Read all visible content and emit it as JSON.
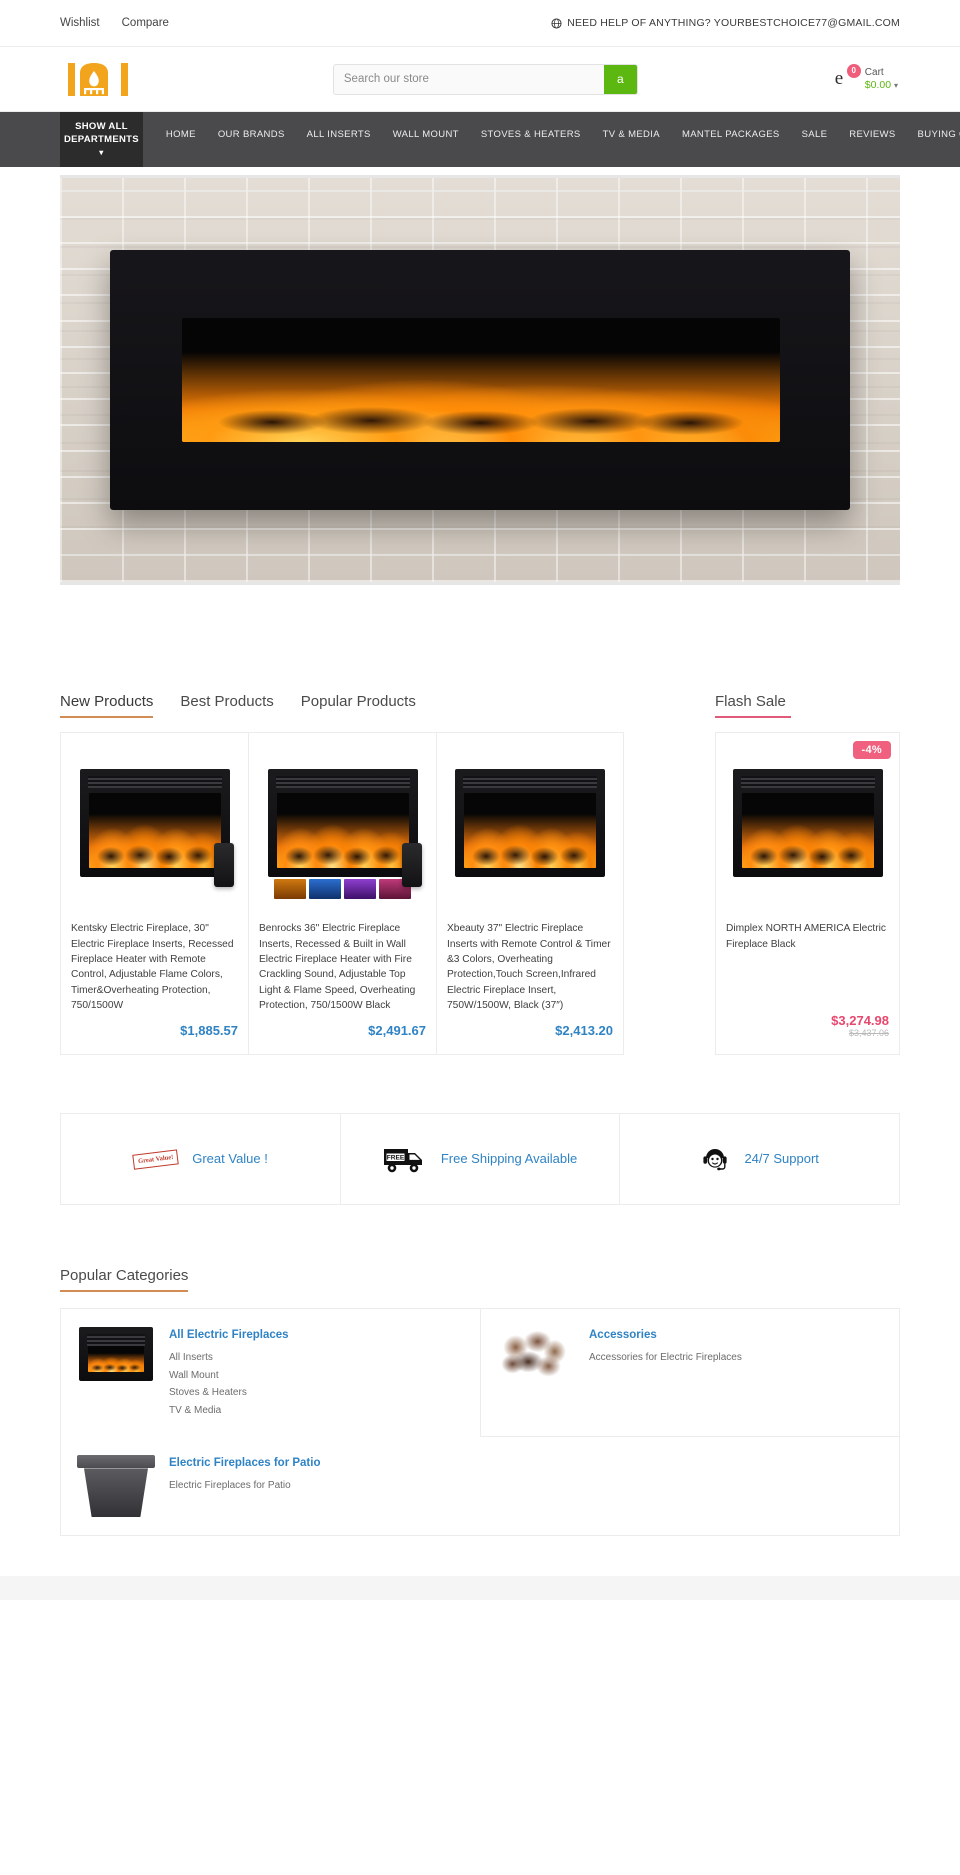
{
  "topbar": {
    "wishlist": "Wishlist",
    "compare": "Compare",
    "help_icon": "globe-icon",
    "help_text": "NEED HELP OF ANYTHING? YOURBESTCHOICE77@GMAIL.COM"
  },
  "header": {
    "logo_icon": "fireplace-logo-icon",
    "search": {
      "placeholder": "Search our store",
      "value": "",
      "button_label": "a",
      "button_color": "#5cb811"
    },
    "cart": {
      "icon_glyph": "e",
      "badge_count": "0",
      "label": "Cart",
      "total": "$0.00",
      "caret": "▾",
      "badge_color": "#f05d7a",
      "total_color": "#5cb811"
    }
  },
  "nav": {
    "departments_button": "SHOW ALL DEPARTMENTS",
    "departments_caret": "▾",
    "links": [
      "HOME",
      "OUR BRANDS",
      "ALL INSERTS",
      "WALL MOUNT",
      "STOVES & HEATERS",
      "TV & MEDIA",
      "MANTEL PACKAGES",
      "SALE",
      "REVIEWS",
      "BUYING GUIDE"
    ]
  },
  "hero": {
    "alt": "wall-mounted electric fireplace on white brick wall"
  },
  "products_section": {
    "tabs": [
      {
        "label": "New Products",
        "active": true
      },
      {
        "label": "Best Products",
        "active": false
      },
      {
        "label": "Popular Products",
        "active": false
      }
    ],
    "tab_accent": "#d08c52",
    "flash_heading": "Flash Sale",
    "flash_accent": "#e05a7a",
    "items": [
      {
        "title": "Kentsky Electric Fireplace, 30\" Electric Fireplace Inserts, Recessed Fireplace Heater with Remote Control, Adjustable Flame Colors, Timer&Overheating Protection, 750/1500W",
        "price": "$1,885.57"
      },
      {
        "title": "Benrocks 36\" Electric Fireplace Inserts, Recessed & Built in Wall Electric Fireplace Heater with Fire Crackling Sound, Adjustable Top Light & Flame Speed, Overheating Protection, 750/1500W Black",
        "price": "$2,491.67"
      },
      {
        "title": "Xbeauty 37\" Electric Fireplace Inserts with Remote Control & Timer &3 Colors, Overheating Protection,Touch Screen,Infrared Electric Fireplace Insert, 750W/1500W, Black (37″)",
        "price": "$2,413.20"
      }
    ],
    "flash_item": {
      "badge": "-4%",
      "title": "Dimplex NORTH AMERICA Electric Fireplace Black",
      "price": "$3,274.98",
      "old_price": "$3,437.06"
    },
    "price_color": "#2f83c4",
    "sale_price_color": "#e8476d"
  },
  "features": [
    {
      "icon": "great-value-stamp-icon",
      "stamp_text": "Great Value!",
      "label": "Great Value !"
    },
    {
      "icon": "free-shipping-truck-icon",
      "truck_text": "FREE",
      "label": "Free Shipping Available"
    },
    {
      "icon": "support-headset-icon",
      "label": "24/7 Support"
    }
  ],
  "popular_categories": {
    "heading": "Popular Categories",
    "accent": "#d08c52",
    "cells": [
      {
        "thumb": "fireplace-insert-thumb",
        "name": "All Electric Fireplaces",
        "sub": "All Inserts\nWall Mount\nStoves & Heaters\nTV & Media"
      },
      {
        "thumb": "log-set-thumb",
        "name": "Accessories",
        "sub": "Accessories for Electric Fireplaces"
      },
      {
        "thumb": "patio-firepit-thumb",
        "name": "Electric Fireplaces for Patio",
        "sub": "Electric Fireplaces for Patio"
      }
    ]
  }
}
